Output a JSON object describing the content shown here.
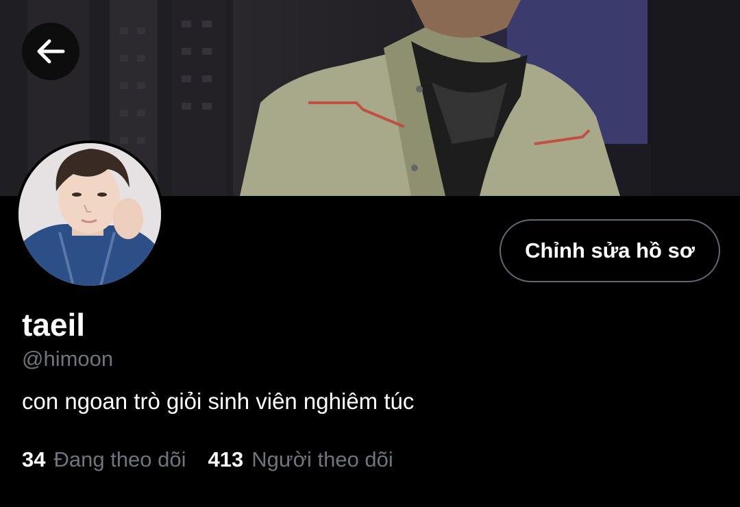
{
  "header": {
    "back_icon": "arrow-left-icon"
  },
  "profile": {
    "display_name": "taeil",
    "handle": "@himoon",
    "bio": "con ngoan trò giỏi sinh viên nghiêm túc",
    "edit_button_label": "Chỉnh sửa hồ sơ"
  },
  "stats": {
    "following_count": "34",
    "following_label": "Đang theo dõi",
    "followers_count": "413",
    "followers_label": "Người theo dõi"
  },
  "colors": {
    "background": "#000000",
    "primary_text": "#ffffff",
    "secondary_text": "#6e767d",
    "button_border": "#5f6b73"
  }
}
